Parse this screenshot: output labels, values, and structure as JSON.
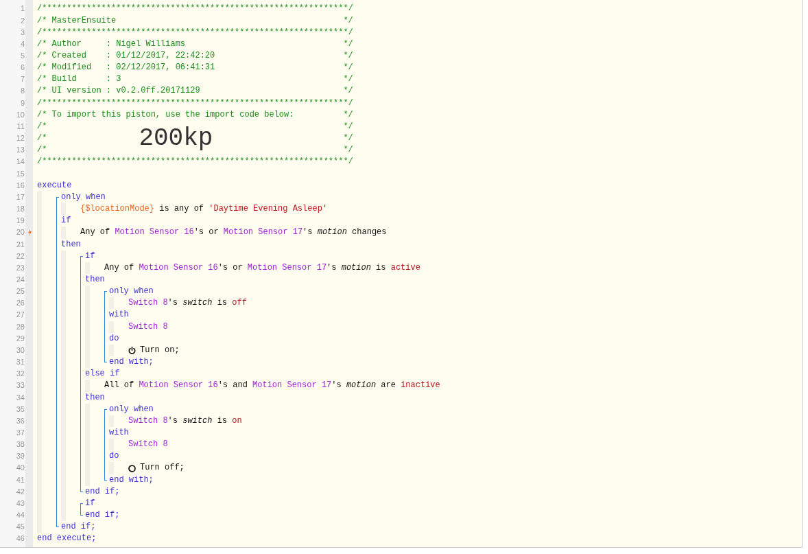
{
  "editor": {
    "header": [
      {
        "number": "1",
        "text": "/**************************************************************/"
      },
      {
        "number": "2",
        "text": "/* MasterEnsuite",
        "close": "*/"
      },
      {
        "number": "3",
        "text": "/**************************************************************/"
      },
      {
        "number": "4",
        "text": "/* Author     : Nigel Williams",
        "close": "*/"
      },
      {
        "number": "5",
        "text": "/* Created    : 01/12/2017, 22:42:20",
        "close": "*/"
      },
      {
        "number": "6",
        "text": "/* Modified   : 02/12/2017, 06:41:31",
        "close": "*/"
      },
      {
        "number": "7",
        "text": "/* Build      : 3",
        "close": "*/"
      },
      {
        "number": "8",
        "text": "/* UI version : v0.2.0ff.20171129",
        "close": "*/"
      },
      {
        "number": "9",
        "text": "/**************************************************************/"
      },
      {
        "number": "10",
        "text": "/* To import this piston, use the import code below:",
        "close": "*/"
      },
      {
        "number": "11",
        "text": "/*",
        "close": "*/"
      },
      {
        "number": "12",
        "text": "/*",
        "import_code": "200kp",
        "close": "*/"
      },
      {
        "number": "13",
        "text": "/*",
        "close": "*/"
      },
      {
        "number": "14",
        "text": "/**************************************************************/"
      },
      {
        "number": "15"
      }
    ],
    "code": [
      {
        "kind": "line",
        "number": "16",
        "trigger": false,
        "tokens": [
          {
            "kind": "keyword",
            "text": "execute"
          }
        ],
        "children": [
          {
            "kind": "block",
            "items": [
              {
                "kind": "line",
                "number": "17",
                "trigger": false,
                "tokens": [
                  {
                    "kind": "keyword",
                    "text": "only when"
                  }
                ],
                "children": [
                  {
                    "kind": "line",
                    "number": "18",
                    "trigger": false,
                    "tokens": [
                      {
                        "kind": "variable",
                        "text": "{$locationMode}"
                      },
                      {
                        "kind": "plain",
                        "text": " is any of "
                      },
                      {
                        "kind": "string",
                        "text": "'Daytime Evening Asleep'"
                      }
                    ]
                  }
                ]
              },
              {
                "kind": "line",
                "number": "19",
                "trigger": false,
                "tokens": [
                  {
                    "kind": "keyword",
                    "text": "if"
                  }
                ],
                "children": [
                  {
                    "kind": "line",
                    "number": "20",
                    "trigger": true,
                    "tokens": [
                      {
                        "kind": "plain",
                        "text": "Any of "
                      },
                      {
                        "kind": "device",
                        "text": "Motion Sensor 16"
                      },
                      {
                        "kind": "plain",
                        "text": "'s or "
                      },
                      {
                        "kind": "device",
                        "text": "Motion Sensor 17"
                      },
                      {
                        "kind": "plain",
                        "text": "'s "
                      },
                      {
                        "kind": "attribute",
                        "text": "motion"
                      },
                      {
                        "kind": "plain",
                        "text": " changes"
                      }
                    ]
                  }
                ]
              },
              {
                "kind": "line",
                "number": "21",
                "trigger": false,
                "tokens": [
                  {
                    "kind": "keyword",
                    "text": "then"
                  }
                ],
                "children": [
                  {
                    "kind": "block",
                    "items": [
                      {
                        "kind": "line",
                        "number": "22",
                        "trigger": false,
                        "tokens": [
                          {
                            "kind": "keyword",
                            "text": "if"
                          }
                        ],
                        "children": [
                          {
                            "kind": "line",
                            "number": "23",
                            "trigger": false,
                            "tokens": [
                              {
                                "kind": "plain",
                                "text": "Any of "
                              },
                              {
                                "kind": "device",
                                "text": "Motion Sensor 16"
                              },
                              {
                                "kind": "plain",
                                "text": "'s or "
                              },
                              {
                                "kind": "device",
                                "text": "Motion Sensor 17"
                              },
                              {
                                "kind": "plain",
                                "text": "'s "
                              },
                              {
                                "kind": "attribute",
                                "text": "motion"
                              },
                              {
                                "kind": "plain",
                                "text": " is "
                              },
                              {
                                "kind": "value",
                                "text": "active"
                              }
                            ]
                          }
                        ]
                      },
                      {
                        "kind": "line",
                        "number": "24",
                        "trigger": false,
                        "tokens": [
                          {
                            "kind": "keyword",
                            "text": "then"
                          }
                        ],
                        "children": [
                          {
                            "kind": "block",
                            "items": [
                              {
                                "kind": "line",
                                "number": "25",
                                "trigger": false,
                                "tokens": [
                                  {
                                    "kind": "keyword",
                                    "text": "only when"
                                  }
                                ],
                                "children": [
                                  {
                                    "kind": "line",
                                    "number": "26",
                                    "trigger": false,
                                    "tokens": [
                                      {
                                        "kind": "device",
                                        "text": "Switch 8"
                                      },
                                      {
                                        "kind": "plain",
                                        "text": "'s "
                                      },
                                      {
                                        "kind": "attribute",
                                        "text": "switch"
                                      },
                                      {
                                        "kind": "plain",
                                        "text": " is "
                                      },
                                      {
                                        "kind": "value",
                                        "text": "off"
                                      }
                                    ]
                                  }
                                ]
                              },
                              {
                                "kind": "line",
                                "number": "27",
                                "trigger": false,
                                "tokens": [
                                  {
                                    "kind": "keyword",
                                    "text": "with"
                                  }
                                ],
                                "children": [
                                  {
                                    "kind": "line",
                                    "number": "28",
                                    "trigger": false,
                                    "tokens": [
                                      {
                                        "kind": "device",
                                        "text": "Switch 8"
                                      }
                                    ]
                                  }
                                ]
                              },
                              {
                                "kind": "line",
                                "number": "29",
                                "trigger": false,
                                "tokens": [
                                  {
                                    "kind": "keyword",
                                    "text": "do"
                                  }
                                ],
                                "children": [
                                  {
                                    "kind": "line",
                                    "number": "30",
                                    "trigger": false,
                                    "tokens": [
                                      {
                                        "kind": "power_icon"
                                      },
                                      {
                                        "kind": "plain",
                                        "text": "Turn on;"
                                      }
                                    ]
                                  }
                                ]
                              },
                              {
                                "kind": "line",
                                "number": "31",
                                "trigger": false,
                                "tokens": [
                                  {
                                    "kind": "keyword",
                                    "text": "end with;"
                                  }
                                ]
                              }
                            ]
                          }
                        ]
                      },
                      {
                        "kind": "line",
                        "number": "32",
                        "trigger": false,
                        "tokens": [
                          {
                            "kind": "keyword",
                            "text": "else if"
                          }
                        ],
                        "children": [
                          {
                            "kind": "line",
                            "number": "33",
                            "trigger": false,
                            "tokens": [
                              {
                                "kind": "plain",
                                "text": "All of "
                              },
                              {
                                "kind": "device",
                                "text": "Motion Sensor 16"
                              },
                              {
                                "kind": "plain",
                                "text": "'s and "
                              },
                              {
                                "kind": "device",
                                "text": "Motion Sensor 17"
                              },
                              {
                                "kind": "plain",
                                "text": "'s "
                              },
                              {
                                "kind": "attribute",
                                "text": "motion"
                              },
                              {
                                "kind": "plain",
                                "text": " are "
                              },
                              {
                                "kind": "value",
                                "text": "inactive"
                              }
                            ]
                          }
                        ]
                      },
                      {
                        "kind": "line",
                        "number": "34",
                        "trigger": false,
                        "tokens": [
                          {
                            "kind": "keyword",
                            "text": "then"
                          }
                        ],
                        "children": [
                          {
                            "kind": "block",
                            "items": [
                              {
                                "kind": "line",
                                "number": "35",
                                "trigger": false,
                                "tokens": [
                                  {
                                    "kind": "keyword",
                                    "text": "only when"
                                  }
                                ],
                                "children": [
                                  {
                                    "kind": "line",
                                    "number": "36",
                                    "trigger": false,
                                    "tokens": [
                                      {
                                        "kind": "device",
                                        "text": "Switch 8"
                                      },
                                      {
                                        "kind": "plain",
                                        "text": "'s "
                                      },
                                      {
                                        "kind": "attribute",
                                        "text": "switch"
                                      },
                                      {
                                        "kind": "plain",
                                        "text": " is "
                                      },
                                      {
                                        "kind": "value",
                                        "text": "on"
                                      }
                                    ]
                                  }
                                ]
                              },
                              {
                                "kind": "line",
                                "number": "37",
                                "trigger": false,
                                "tokens": [
                                  {
                                    "kind": "keyword",
                                    "text": "with"
                                  }
                                ],
                                "children": [
                                  {
                                    "kind": "line",
                                    "number": "38",
                                    "trigger": false,
                                    "tokens": [
                                      {
                                        "kind": "device",
                                        "text": "Switch 8"
                                      }
                                    ]
                                  }
                                ]
                              },
                              {
                                "kind": "line",
                                "number": "39",
                                "trigger": false,
                                "tokens": [
                                  {
                                    "kind": "keyword",
                                    "text": "do"
                                  }
                                ],
                                "children": [
                                  {
                                    "kind": "line",
                                    "number": "40",
                                    "trigger": false,
                                    "tokens": [
                                      {
                                        "kind": "circle_icon"
                                      },
                                      {
                                        "kind": "plain",
                                        "text": "Turn off;"
                                      }
                                    ]
                                  }
                                ]
                              },
                              {
                                "kind": "line",
                                "number": "41",
                                "trigger": false,
                                "tokens": [
                                  {
                                    "kind": "keyword",
                                    "text": "end with;"
                                  }
                                ]
                              }
                            ]
                          }
                        ]
                      },
                      {
                        "kind": "line",
                        "number": "42",
                        "trigger": false,
                        "tokens": [
                          {
                            "kind": "keyword",
                            "text": "end if;"
                          }
                        ]
                      }
                    ]
                  },
                  {
                    "kind": "block",
                    "items": [
                      {
                        "kind": "line",
                        "number": "43",
                        "trigger": false,
                        "tokens": [
                          {
                            "kind": "keyword",
                            "text": "if"
                          }
                        ]
                      },
                      {
                        "kind": "line",
                        "number": "44",
                        "trigger": false,
                        "tokens": [
                          {
                            "kind": "keyword",
                            "text": "end if;"
                          }
                        ]
                      }
                    ]
                  }
                ]
              },
              {
                "kind": "line",
                "number": "45",
                "trigger": false,
                "tokens": [
                  {
                    "kind": "keyword",
                    "text": "end if;"
                  }
                ]
              }
            ]
          }
        ]
      },
      {
        "kind": "line",
        "number": "46",
        "trigger": false,
        "tokens": [
          {
            "kind": "keyword",
            "text": "end execute;"
          }
        ]
      }
    ]
  }
}
